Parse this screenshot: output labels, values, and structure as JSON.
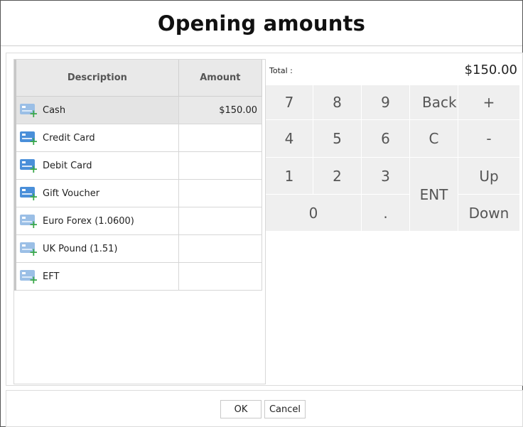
{
  "title": "Opening amounts",
  "table": {
    "headers": {
      "description": "Description",
      "amount": "Amount"
    },
    "rows": [
      {
        "description": "Cash",
        "amount": "$150.00",
        "selected": true,
        "icon": "card-add-icon"
      },
      {
        "description": "Credit Card",
        "amount": "",
        "selected": false,
        "icon": "card-add-icon"
      },
      {
        "description": "Debit Card",
        "amount": "",
        "selected": false,
        "icon": "card-add-icon"
      },
      {
        "description": "Gift Voucher",
        "amount": "",
        "selected": false,
        "icon": "card-add-icon"
      },
      {
        "description": "Euro Forex (1.0600)",
        "amount": "",
        "selected": false,
        "icon": "card-add-icon"
      },
      {
        "description": "UK Pound (1.51)",
        "amount": "",
        "selected": false,
        "icon": "card-add-icon"
      },
      {
        "description": "EFT",
        "amount": "",
        "selected": false,
        "icon": "card-add-icon"
      }
    ]
  },
  "total": {
    "label": "Total :",
    "value": "$150.00"
  },
  "keypad": {
    "k7": "7",
    "k8": "8",
    "k9": "9",
    "back": "Back",
    "plus": "+",
    "k4": "4",
    "k5": "5",
    "k6": "6",
    "clear": "C",
    "minus": "-",
    "k1": "1",
    "k2": "2",
    "k3": "3",
    "enter": "ENT",
    "up": "Up",
    "k0": "0",
    "dot": ".",
    "down": "Down"
  },
  "footer": {
    "ok": "OK",
    "cancel": "Cancel"
  }
}
